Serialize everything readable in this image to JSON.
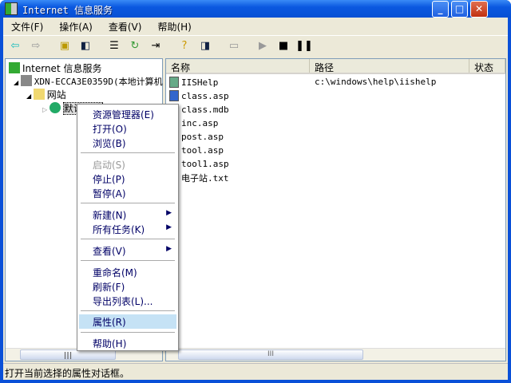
{
  "window": {
    "title": "Internet 信息服务",
    "min": "_",
    "max": "□",
    "close": "✕"
  },
  "menubar": [
    "文件(F)",
    "操作(A)",
    "查看(V)",
    "帮助(H)"
  ],
  "toolbar": [
    "back-icon",
    "forward-icon",
    "up-folder-icon",
    "show-tree-icon",
    "properties-icon",
    "refresh-icon",
    "export-icon",
    "help-icon",
    "show-pane-icon",
    "computer-icon",
    "play-icon",
    "stop-icon",
    "pause-icon"
  ],
  "tree": {
    "root": "Internet 信息服务",
    "computer": "XDN-ECCA3E0359D(本地计算机",
    "websites": "网站",
    "default_site": "默认网站"
  },
  "list": {
    "columns": [
      "名称",
      "路径",
      "状态"
    ],
    "rows": [
      {
        "name": "IISHelp",
        "path": "c:\\windows\\help\\iishelp"
      },
      {
        "name": "class.asp",
        "path": ""
      },
      {
        "name": "class.mdb",
        "path": ""
      },
      {
        "name": "inc.asp",
        "path": ""
      },
      {
        "name": "post.asp",
        "path": ""
      },
      {
        "name": "tool.asp",
        "path": ""
      },
      {
        "name": "tool1.asp",
        "path": ""
      },
      {
        "name": "电子站.txt",
        "path": ""
      }
    ]
  },
  "context_menu": {
    "items": [
      "资源管理器(E)",
      "打开(O)",
      "浏览(B)",
      "启动(S)",
      "停止(P)",
      "暂停(A)",
      "新建(N)",
      "所有任务(K)",
      "查看(V)",
      "重命名(M)",
      "刷新(F)",
      "导出列表(L)...",
      "属性(R)",
      "帮助(H)"
    ]
  },
  "scroll": {
    "thumb": "III"
  },
  "status": "打开当前选择的属性对话框。"
}
